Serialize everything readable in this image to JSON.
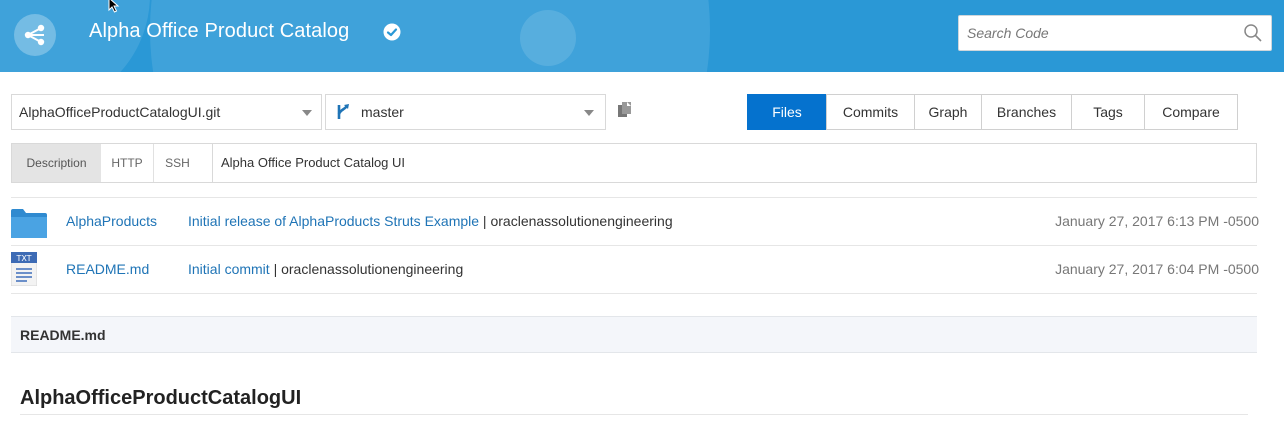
{
  "header": {
    "title": "Alpha Office Product Catalog",
    "search_placeholder": "Search Code",
    "bg_color": "#2a98d6"
  },
  "toolbar": {
    "repo": "AlphaOfficeProductCatalogUI.git",
    "branch": "master",
    "tabs": [
      {
        "label": "Files",
        "active": true
      },
      {
        "label": "Commits",
        "active": false
      },
      {
        "label": "Graph",
        "active": false
      },
      {
        "label": "Branches",
        "active": false
      },
      {
        "label": "Tags",
        "active": false
      },
      {
        "label": "Compare",
        "active": false
      }
    ],
    "active_color": "#0572ce"
  },
  "clone": {
    "tabs": [
      {
        "label": "Description",
        "active": true
      },
      {
        "label": "HTTP",
        "active": false
      },
      {
        "label": "SSH",
        "active": false
      }
    ],
    "value": "Alpha Office Product Catalog UI"
  },
  "files": [
    {
      "icon": "folder-icon",
      "name": "AlphaProducts",
      "message": "Initial release of AlphaProducts Struts Example",
      "author": "oraclenassolutionengineering",
      "date": "January 27, 2017 6:13 PM -0500"
    },
    {
      "icon": "txt-file-icon",
      "icon_label": "TXT",
      "name": "README.md",
      "message": "Initial commit",
      "author": "oraclenassolutionengineering",
      "date": "January 27, 2017 6:04 PM -0500"
    }
  ],
  "readme": {
    "filename": "README.md",
    "heading": "AlphaOfficeProductCatalogUI"
  }
}
